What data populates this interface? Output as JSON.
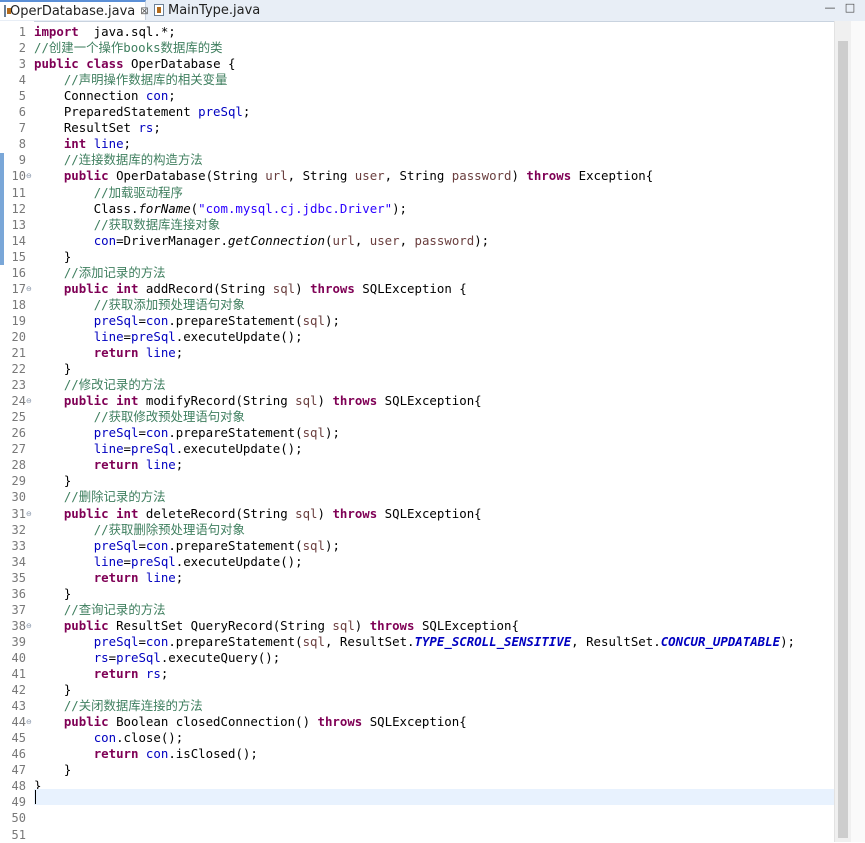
{
  "tabs": [
    {
      "label": "OperDatabase.java",
      "close": "⊠",
      "active": true
    },
    {
      "label": "MainType.java",
      "active": false
    }
  ],
  "window_controls": {
    "minimize": "—",
    "maximize": "□"
  },
  "lines": [
    {
      "n": "1",
      "segs": [
        [
          "kw",
          "import"
        ],
        [
          "",
          "  java.sql.*;"
        ]
      ]
    },
    {
      "n": "2",
      "segs": [
        [
          "cm",
          "//创建一个操作books数据库的类"
        ]
      ]
    },
    {
      "n": "3",
      "segs": [
        [
          "kw",
          "public"
        ],
        [
          "",
          " "
        ],
        [
          "kw",
          "class"
        ],
        [
          "",
          " OperDatabase {"
        ]
      ]
    },
    {
      "n": "4",
      "segs": [
        [
          "",
          "    "
        ],
        [
          "cm",
          "//声明操作数据库的相关变量"
        ]
      ]
    },
    {
      "n": "5",
      "segs": [
        [
          "",
          "    Connection "
        ],
        [
          "fd",
          "con"
        ],
        [
          "",
          ";"
        ]
      ]
    },
    {
      "n": "6",
      "segs": [
        [
          "",
          "    PreparedStatement "
        ],
        [
          "fd",
          "preSql"
        ],
        [
          "",
          ";"
        ]
      ]
    },
    {
      "n": "7",
      "segs": [
        [
          "",
          "    ResultSet "
        ],
        [
          "fd",
          "rs"
        ],
        [
          "",
          ";"
        ]
      ]
    },
    {
      "n": "8",
      "segs": [
        [
          "",
          "    "
        ],
        [
          "kw",
          "int"
        ],
        [
          "",
          " "
        ],
        [
          "fd",
          "line"
        ],
        [
          "",
          ";"
        ]
      ]
    },
    {
      "n": "9",
      "segs": [
        [
          "",
          "    "
        ],
        [
          "cm",
          "//连接数据库的构造方法"
        ]
      ]
    },
    {
      "n": "10",
      "fold": true,
      "segs": [
        [
          "",
          "    "
        ],
        [
          "kw",
          "public"
        ],
        [
          "",
          " OperDatabase(String "
        ],
        [
          "pr",
          "url"
        ],
        [
          "",
          ", String "
        ],
        [
          "pr",
          "user"
        ],
        [
          "",
          ", String "
        ],
        [
          "pr",
          "password"
        ],
        [
          "",
          ") "
        ],
        [
          "kw",
          "throws"
        ],
        [
          "",
          " Exception{"
        ]
      ]
    },
    {
      "n": "11",
      "segs": [
        [
          "",
          "        "
        ],
        [
          "cm",
          "//加载驱动程序"
        ]
      ]
    },
    {
      "n": "12",
      "segs": [
        [
          "",
          "        Class."
        ],
        [
          "it",
          "forName"
        ],
        [
          "",
          "("
        ],
        [
          "st",
          "\"com.mysql.cj.jdbc.Driver\""
        ],
        [
          "",
          ");"
        ]
      ]
    },
    {
      "n": "13",
      "segs": [
        [
          "",
          "        "
        ],
        [
          "cm",
          "//获取数据库连接对象"
        ]
      ]
    },
    {
      "n": "14",
      "segs": [
        [
          "",
          "        "
        ],
        [
          "fd",
          "con"
        ],
        [
          "",
          "=DriverManager."
        ],
        [
          "it",
          "getConnection"
        ],
        [
          "",
          "("
        ],
        [
          "pr",
          "url"
        ],
        [
          "",
          ", "
        ],
        [
          "pr",
          "user"
        ],
        [
          "",
          ", "
        ],
        [
          "pr",
          "password"
        ],
        [
          "",
          ");"
        ]
      ]
    },
    {
      "n": "15",
      "segs": [
        [
          "",
          "    }"
        ]
      ]
    },
    {
      "n": "16",
      "segs": [
        [
          "",
          "    "
        ],
        [
          "cm",
          "//添加记录的方法"
        ]
      ]
    },
    {
      "n": "17",
      "fold": true,
      "segs": [
        [
          "",
          "    "
        ],
        [
          "kw",
          "public"
        ],
        [
          "",
          " "
        ],
        [
          "kw",
          "int"
        ],
        [
          "",
          " addRecord(String "
        ],
        [
          "pr",
          "sql"
        ],
        [
          "",
          ") "
        ],
        [
          "kw",
          "throws"
        ],
        [
          "",
          " SQLException {"
        ]
      ]
    },
    {
      "n": "18",
      "segs": [
        [
          "",
          "        "
        ],
        [
          "cm",
          "//获取添加预处理语句对象"
        ]
      ]
    },
    {
      "n": "19",
      "segs": [
        [
          "",
          "        "
        ],
        [
          "fd",
          "preSql"
        ],
        [
          "",
          "="
        ],
        [
          "fd",
          "con"
        ],
        [
          "",
          ".prepareStatement("
        ],
        [
          "pr",
          "sql"
        ],
        [
          "",
          ");"
        ]
      ]
    },
    {
      "n": "20",
      "segs": [
        [
          "",
          "        "
        ],
        [
          "fd",
          "line"
        ],
        [
          "",
          "="
        ],
        [
          "fd",
          "preSql"
        ],
        [
          "",
          ".executeUpdate();"
        ]
      ]
    },
    {
      "n": "21",
      "segs": [
        [
          "",
          "        "
        ],
        [
          "kw",
          "return"
        ],
        [
          "",
          " "
        ],
        [
          "fd",
          "line"
        ],
        [
          "",
          ";"
        ]
      ]
    },
    {
      "n": "22",
      "segs": [
        [
          "",
          "    }"
        ]
      ]
    },
    {
      "n": "23",
      "segs": [
        [
          "",
          "    "
        ],
        [
          "cm",
          "//修改记录的方法"
        ]
      ]
    },
    {
      "n": "24",
      "fold": true,
      "segs": [
        [
          "",
          "    "
        ],
        [
          "kw",
          "public"
        ],
        [
          "",
          " "
        ],
        [
          "kw",
          "int"
        ],
        [
          "",
          " modifyRecord(String "
        ],
        [
          "pr",
          "sql"
        ],
        [
          "",
          ") "
        ],
        [
          "kw",
          "throws"
        ],
        [
          "",
          " SQLException{"
        ]
      ]
    },
    {
      "n": "25",
      "segs": [
        [
          "",
          "        "
        ],
        [
          "cm",
          "//获取修改预处理语句对象"
        ]
      ]
    },
    {
      "n": "26",
      "segs": [
        [
          "",
          "        "
        ],
        [
          "fd",
          "preSql"
        ],
        [
          "",
          "="
        ],
        [
          "fd",
          "con"
        ],
        [
          "",
          ".prepareStatement("
        ],
        [
          "pr",
          "sql"
        ],
        [
          "",
          ");"
        ]
      ]
    },
    {
      "n": "27",
      "segs": [
        [
          "",
          "        "
        ],
        [
          "fd",
          "line"
        ],
        [
          "",
          "="
        ],
        [
          "fd",
          "preSql"
        ],
        [
          "",
          ".executeUpdate();"
        ]
      ]
    },
    {
      "n": "28",
      "segs": [
        [
          "",
          "        "
        ],
        [
          "kw",
          "return"
        ],
        [
          "",
          " "
        ],
        [
          "fd",
          "line"
        ],
        [
          "",
          ";"
        ]
      ]
    },
    {
      "n": "29",
      "segs": [
        [
          "",
          "    }"
        ]
      ]
    },
    {
      "n": "30",
      "segs": [
        [
          "",
          "    "
        ],
        [
          "cm",
          "//删除记录的方法"
        ]
      ]
    },
    {
      "n": "31",
      "fold": true,
      "segs": [
        [
          "",
          "    "
        ],
        [
          "kw",
          "public"
        ],
        [
          "",
          " "
        ],
        [
          "kw",
          "int"
        ],
        [
          "",
          " deleteRecord(String "
        ],
        [
          "pr",
          "sql"
        ],
        [
          "",
          ") "
        ],
        [
          "kw",
          "throws"
        ],
        [
          "",
          " SQLException{"
        ]
      ]
    },
    {
      "n": "32",
      "segs": [
        [
          "",
          "        "
        ],
        [
          "cm",
          "//获取删除预处理语句对象"
        ]
      ]
    },
    {
      "n": "33",
      "segs": [
        [
          "",
          "        "
        ],
        [
          "fd",
          "preSql"
        ],
        [
          "",
          "="
        ],
        [
          "fd",
          "con"
        ],
        [
          "",
          ".prepareStatement("
        ],
        [
          "pr",
          "sql"
        ],
        [
          "",
          ");"
        ]
      ]
    },
    {
      "n": "34",
      "segs": [
        [
          "",
          "        "
        ],
        [
          "fd",
          "line"
        ],
        [
          "",
          "="
        ],
        [
          "fd",
          "preSql"
        ],
        [
          "",
          ".executeUpdate();"
        ]
      ]
    },
    {
      "n": "35",
      "segs": [
        [
          "",
          "        "
        ],
        [
          "kw",
          "return"
        ],
        [
          "",
          " "
        ],
        [
          "fd",
          "line"
        ],
        [
          "",
          ";"
        ]
      ]
    },
    {
      "n": "36",
      "segs": [
        [
          "",
          "    }"
        ]
      ]
    },
    {
      "n": "37",
      "segs": [
        [
          "",
          "    "
        ],
        [
          "cm",
          "//查询记录的方法"
        ]
      ]
    },
    {
      "n": "38",
      "fold": true,
      "segs": [
        [
          "",
          "    "
        ],
        [
          "kw",
          "public"
        ],
        [
          "",
          " ResultSet QueryRecord(String "
        ],
        [
          "pr",
          "sql"
        ],
        [
          "",
          ") "
        ],
        [
          "kw",
          "throws"
        ],
        [
          "",
          " SQLException{"
        ]
      ]
    },
    {
      "n": "39",
      "segs": [
        [
          "",
          "        "
        ],
        [
          "fd",
          "preSql"
        ],
        [
          "",
          "="
        ],
        [
          "fd",
          "con"
        ],
        [
          "",
          ".prepareStatement("
        ],
        [
          "pr",
          "sql"
        ],
        [
          "",
          ", ResultSet."
        ],
        [
          "sf",
          "TYPE_SCROLL_SENSITIVE"
        ],
        [
          "",
          ", ResultSet."
        ],
        [
          "sf",
          "CONCUR_UPDATABLE"
        ],
        [
          "",
          ");"
        ]
      ]
    },
    {
      "n": "40",
      "segs": [
        [
          "",
          "        "
        ],
        [
          "fd",
          "rs"
        ],
        [
          "",
          "="
        ],
        [
          "fd",
          "preSql"
        ],
        [
          "",
          ".executeQuery();"
        ]
      ]
    },
    {
      "n": "41",
      "segs": [
        [
          "",
          "        "
        ],
        [
          "kw",
          "return"
        ],
        [
          "",
          " "
        ],
        [
          "fd",
          "rs"
        ],
        [
          "",
          ";"
        ]
      ]
    },
    {
      "n": "42",
      "segs": [
        [
          "",
          "    }"
        ]
      ]
    },
    {
      "n": "43",
      "segs": [
        [
          "",
          "    "
        ],
        [
          "cm",
          "//关闭数据库连接的方法"
        ]
      ]
    },
    {
      "n": "44",
      "fold": true,
      "segs": [
        [
          "",
          "    "
        ],
        [
          "kw",
          "public"
        ],
        [
          "",
          " Boolean closedConnection() "
        ],
        [
          "kw",
          "throws"
        ],
        [
          "",
          " SQLException{"
        ]
      ]
    },
    {
      "n": "45",
      "segs": [
        [
          "",
          "        "
        ],
        [
          "fd",
          "con"
        ],
        [
          "",
          ".close();"
        ]
      ]
    },
    {
      "n": "46",
      "segs": [
        [
          "",
          "        "
        ],
        [
          "kw",
          "return"
        ],
        [
          "",
          " "
        ],
        [
          "fd",
          "con"
        ],
        [
          "",
          ".isClosed();"
        ]
      ]
    },
    {
      "n": "47",
      "segs": [
        [
          "",
          "    }"
        ]
      ]
    },
    {
      "n": "48",
      "segs": [
        [
          "",
          "}"
        ]
      ]
    },
    {
      "n": "49",
      "segs": []
    },
    {
      "n": "50",
      "segs": []
    },
    {
      "n": "51",
      "segs": []
    }
  ]
}
